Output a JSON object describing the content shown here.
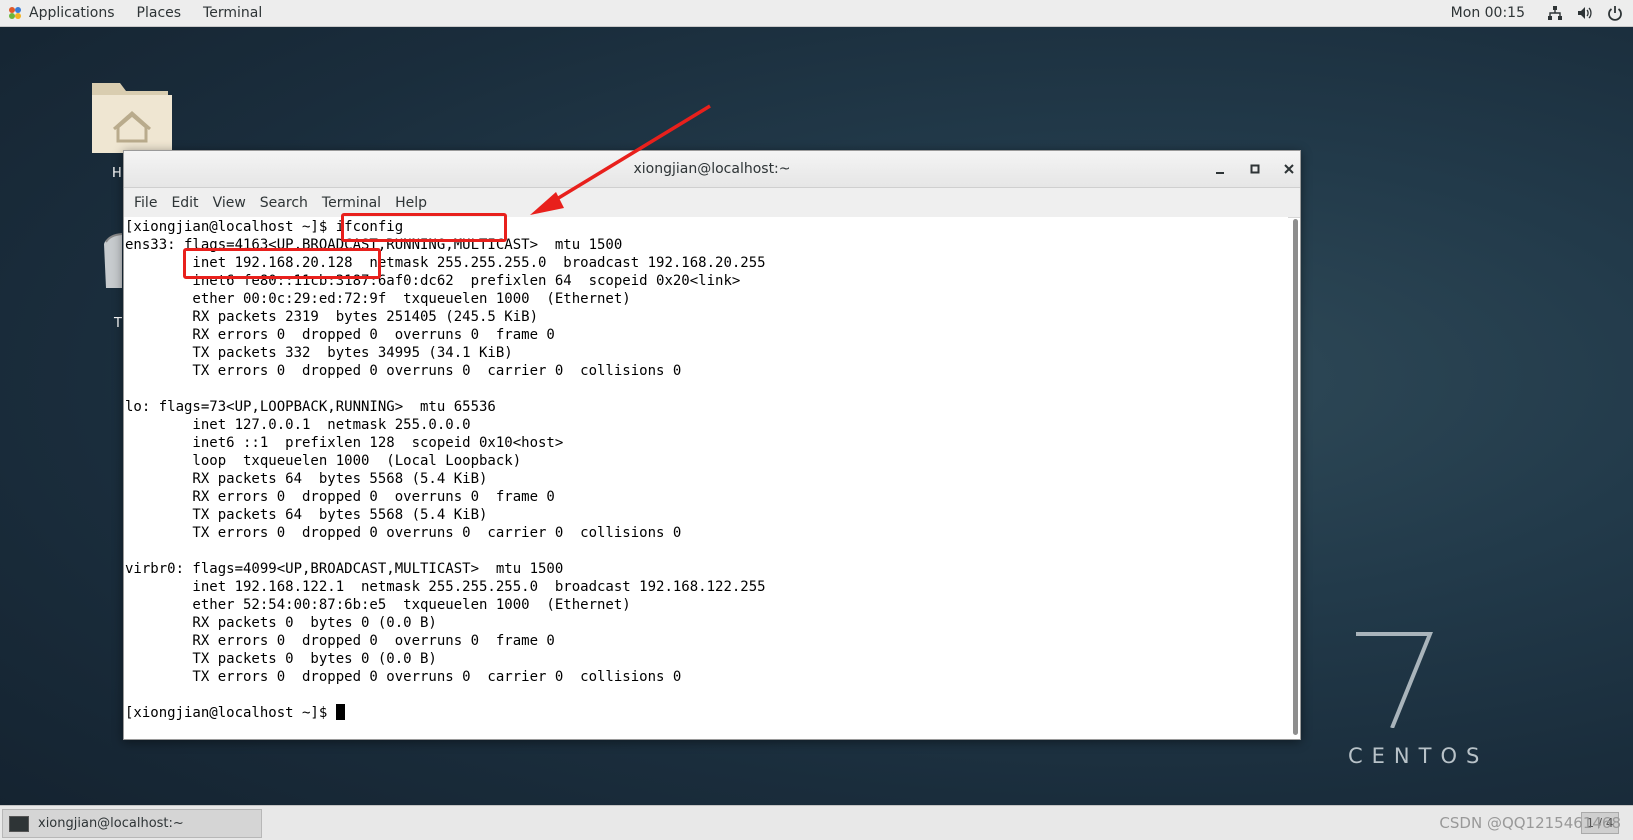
{
  "topbar": {
    "applications": "Applications",
    "places": "Places",
    "terminal": "Terminal",
    "clock": "Mon 00:15",
    "tray_icons": [
      "network-icon",
      "volume-icon",
      "power-icon"
    ]
  },
  "desktop": {
    "home_label": "H",
    "trash_label": "T",
    "centos_version": "7",
    "centos_text": "CENTOS"
  },
  "terminal_window": {
    "title": "xiongjian@localhost:~",
    "menu": [
      "File",
      "Edit",
      "View",
      "Search",
      "Terminal",
      "Help"
    ],
    "lines": [
      "[xiongjian@localhost ~]$ ifconfig",
      "ens33: flags=4163<UP,BROADCAST,RUNNING,MULTICAST>  mtu 1500",
      "        inet 192.168.20.128  netmask 255.255.255.0  broadcast 192.168.20.255",
      "        inet6 fe80::11cb:3187:6af0:dc62  prefixlen 64  scopeid 0x20<link>",
      "        ether 00:0c:29:ed:72:9f  txqueuelen 1000  (Ethernet)",
      "        RX packets 2319  bytes 251405 (245.5 KiB)",
      "        RX errors 0  dropped 0  overruns 0  frame 0",
      "        TX packets 332  bytes 34995 (34.1 KiB)",
      "        TX errors 0  dropped 0 overruns 0  carrier 0  collisions 0",
      "",
      "lo: flags=73<UP,LOOPBACK,RUNNING>  mtu 65536",
      "        inet 127.0.0.1  netmask 255.0.0.0",
      "        inet6 ::1  prefixlen 128  scopeid 0x10<host>",
      "        loop  txqueuelen 1000  (Local Loopback)",
      "        RX packets 64  bytes 5568 (5.4 KiB)",
      "        RX errors 0  dropped 0  overruns 0  frame 0",
      "        TX packets 64  bytes 5568 (5.4 KiB)",
      "        TX errors 0  dropped 0 overruns 0  carrier 0  collisions 0",
      "",
      "virbr0: flags=4099<UP,BROADCAST,MULTICAST>  mtu 1500",
      "        inet 192.168.122.1  netmask 255.255.255.0  broadcast 192.168.122.255",
      "        ether 52:54:00:87:6b:e5  txqueuelen 1000  (Ethernet)",
      "        RX packets 0  bytes 0 (0.0 B)",
      "        RX errors 0  dropped 0  overruns 0  frame 0",
      "        TX packets 0  bytes 0 (0.0 B)",
      "        TX errors 0  dropped 0 overruns 0  carrier 0  collisions 0",
      ""
    ],
    "prompt": "[xiongjian@localhost ~]$ "
  },
  "taskbar": {
    "task_label": "xiongjian@localhost:~",
    "watermark": "CSDN @QQ1215461468",
    "workspace": "1 / 4"
  },
  "colors": {
    "annotation": "#e8201c",
    "desktop": "#1f3545"
  }
}
